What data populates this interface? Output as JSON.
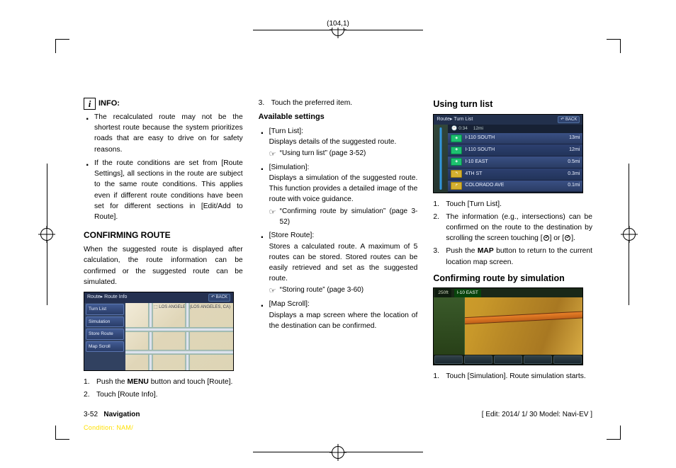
{
  "page_coords": "(104,1)",
  "footer": {
    "page": "3-52",
    "section": "Navigation",
    "edit": "[ Edit: 2014/ 1/ 30   Model:  Navi-EV ]",
    "condition": "Condition: NAM/"
  },
  "col1": {
    "info_label": "INFO:",
    "bullets": [
      "The recalculated route may not be the shortest route because the system prioritizes roads that are easy to drive on for safety reasons.",
      "If the route conditions are set from [Route Settings], all sections in the route are subject to the same route conditions. This applies even if different route conditions have been set for different sections in [Edit/Add to Route]."
    ],
    "h_confirm": "CONFIRMING ROUTE",
    "confirm_body": "When the suggested route is displayed after calculation, the route information can be confirmed or the suggested route can be simulated.",
    "nav_breadcrumb": "Route▸ Route Info",
    "nav_back": "↶ BACK",
    "nav_region": "⬚ LOS ANGELES (LOS ANGELES, CA)",
    "nav_buttons": [
      "Turn List",
      "Simulation",
      "Store Route",
      "Map Scroll"
    ],
    "steps": [
      {
        "n": "1.",
        "t_pre": "Push the ",
        "bold": "MENU",
        "t_post": " button and touch [Route]."
      },
      {
        "n": "2.",
        "t_pre": "Touch [Route Info].",
        "bold": "",
        "t_post": ""
      }
    ]
  },
  "col2": {
    "step3": {
      "n": "3.",
      "t": "Touch the preferred item."
    },
    "h_avail": "Available settings",
    "items": [
      {
        "name": "[Turn List]:",
        "desc": "Displays details of the suggested route.",
        "ref": "“Using turn list” (page 3-52)"
      },
      {
        "name": "[Simulation]:",
        "desc": "Displays a simulation of the suggested route. This function provides a detailed image of the route with voice guidance.",
        "ref": "“Confirming route by simulation” (page 3-52)"
      },
      {
        "name": "[Store Route]:",
        "desc": "Stores a calculated route. A maximum of 5 routes can be stored. Stored routes can be easily retrieved and set as the suggested route.",
        "ref": "“Storing route” (page 3-60)"
      },
      {
        "name": "[Map Scroll]:",
        "desc": "Displays a map screen where the location of the destination can be confirmed.",
        "ref": ""
      }
    ]
  },
  "col3": {
    "h_turn": "Using turn list",
    "turn_breadcrumb": "Route▸ Turn List",
    "turn_back": "↶ BACK",
    "turn_sub_time": "🕘 0:34",
    "turn_sub_dist": "12mi",
    "turn_rows": [
      {
        "name": "I-110 SOUTH",
        "dist": "13mi",
        "ico": "hwy"
      },
      {
        "name": "I-110 SOUTH",
        "dist": "12mi",
        "ico": "hwy"
      },
      {
        "name": "I-10 EAST",
        "dist": "0.5mi",
        "ico": "hwy"
      },
      {
        "name": "4TH ST",
        "dist": "0.3mi",
        "ico": "loc"
      },
      {
        "name": "COLORADO AVE",
        "dist": "0.1mi",
        "ico": "loc"
      }
    ],
    "steps": [
      {
        "n": "1.",
        "t": "Touch [Turn List]."
      },
      {
        "n": "2.",
        "t": "The information (e.g., intersections) can be confirmed on the route to the destination by scrolling the screen touching [",
        "t2": "] or [",
        "t3": "]."
      },
      {
        "n": "3.",
        "t_pre": "Push the ",
        "bold": "MAP",
        "t_post": " button to return to the current location map screen."
      }
    ],
    "h_sim": "Confirming route by simulation",
    "sim_dist": "250ft",
    "sim_route": "I-10 EAST",
    "sim_step": {
      "n": "1.",
      "t": "Touch [Simulation]. Route simulation starts."
    }
  }
}
